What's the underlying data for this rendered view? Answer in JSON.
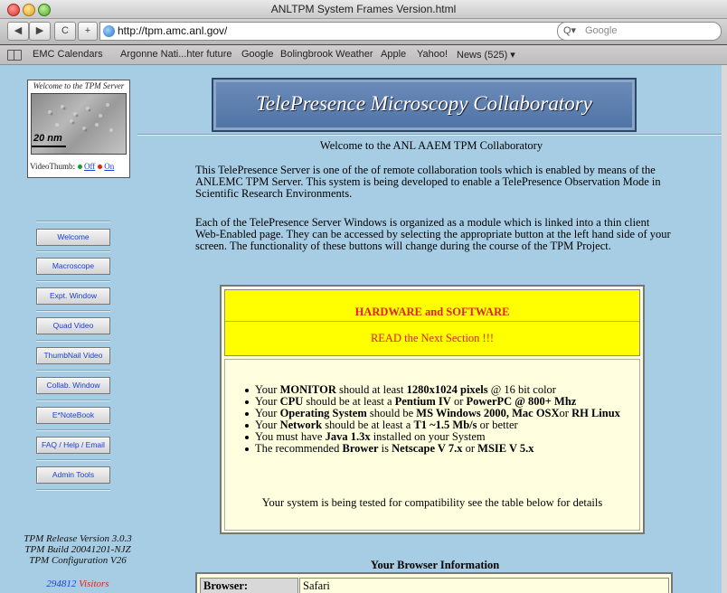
{
  "window": {
    "title": "ANLTPM System Frames Version.html"
  },
  "toolbar": {
    "back": "◀",
    "forward": "▶",
    "reload": "C",
    "add": "+",
    "url": "http://tpm.amc.anl.gov/",
    "search_placeholder": "Google",
    "search_icon": "Q▾",
    "rss_icon": "⌃"
  },
  "bookmarks": [
    "EMC Calendars",
    "Argonne Nati...hter future",
    "Google",
    "Bolingbrook Weather",
    "Apple",
    "Yahoo!",
    "News (525) ▾"
  ],
  "sidebar": {
    "thumb_caption": "Welcome to the TPM Server",
    "scale_label": "20 nm",
    "videothumb_label": "VideoThumb:",
    "off_label": "Off",
    "on_label": "On",
    "buttons": [
      "Welcome",
      "Macroscope",
      "Expt. Window",
      "Quad Video",
      "ThumbNail Video",
      "Collab. Window",
      "E*NoteBook",
      "FAQ / Help / Email",
      "Admin Tools"
    ],
    "release": [
      "TPM Release Version 3.0.3",
      "TPM Build 20041201-NJZ",
      "TPM Configuration V26"
    ],
    "visitor_count": "294812",
    "visitor_label": "Visitors"
  },
  "main": {
    "banner": "TelePresence Microscopy Collaboratory",
    "welcome": "Welcome to the ANL AAEM TPM Collaboratory",
    "para1": "This TelePresence Server is one of the of remote collaboration tools which is enabled by means of the ANLEMC TPM Server. This system is being developed to enable a TelePresence Observation Mode in Scientific Research Environments.",
    "para2": "Each of the TelePresence Server Windows is organized as a module which is linked into a thin client Web-Enabled page. They can be accessed by selecting the appropriate button at the left hand side of your screen. The functionality of these buttons will change during the course of the TPM Project.",
    "hw_title": "HARDWARE and SOFTWARE",
    "hw_sub": "READ the Next Section !!!",
    "requirements": [
      {
        "pre": "Your ",
        "b1": "MONITOR",
        "mid": " should at least ",
        "b2": "1280x1024 pixels",
        "post": " @ 16 bit color"
      },
      {
        "pre": "Your ",
        "b1": "CPU",
        "mid": " should be at least a ",
        "b2": "Pentium IV",
        "post": " or ",
        "b3": "PowerPC @ 800+ Mhz"
      },
      {
        "pre": "Your ",
        "b1": "Operating System",
        "mid": " should be ",
        "b2": "MS Windows 2000, Mac OSX",
        "post": "or ",
        "b3": "RH Linux"
      },
      {
        "pre": "Your ",
        "b1": "Network",
        "mid": " should be at least a ",
        "b2": "T1 ~1.5 Mb/s",
        "post": " or better"
      },
      {
        "pre": "You must have ",
        "b1": "Java 1.3x",
        "mid": " installed on your System"
      },
      {
        "pre": "The recommended ",
        "b1": "Brower",
        "mid": " is ",
        "b2": "Netscape V 7.x",
        "post": " or ",
        "b3": "MSIE V 5.x"
      }
    ],
    "hw_test": "Your system is being tested for compatibility see the table below for details",
    "browser_info_title": "Your Browser Information",
    "browser_label": "Browser:",
    "browser_value": "Safari"
  },
  "colors": {
    "link_blue": "#1a3fd6",
    "warning_red": "#e0201a",
    "hw_yellow": "#ffff00",
    "page_bg": "#a7cde4"
  }
}
